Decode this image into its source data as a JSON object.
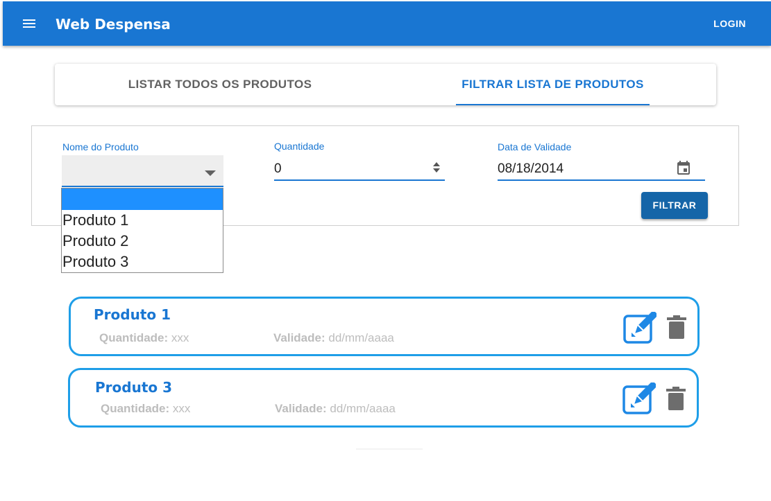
{
  "appbar": {
    "title": "Web Despensa",
    "login_label": "LOGIN"
  },
  "tabs": [
    {
      "label": "LISTAR TODOS OS PRODUTOS",
      "active": false
    },
    {
      "label": "FILTRAR LISTA DE PRODUTOS",
      "active": true
    }
  ],
  "filter": {
    "nome_label": "Nome do Produto",
    "nome_value": "",
    "quantidade_label": "Quantidade",
    "quantidade_value": "0",
    "data_label": "Data de Validade",
    "data_value": "08/18/2014",
    "filtrar_label": "FILTRAR",
    "dropdown_options": [
      "",
      "Produto 1",
      "Produto 2",
      "Produto 3"
    ]
  },
  "products": [
    {
      "name": "Produto 1",
      "quantidade_label": "Quantidade:",
      "quantidade_value": " xxx",
      "validade_label": "Validade:",
      "validade_value": " dd/mm/aaaa"
    },
    {
      "name": "Produto 3",
      "quantidade_label": "Quantidade:",
      "quantidade_value": " xxx",
      "validade_label": "Validade:",
      "validade_value": " dd/mm/aaaa"
    }
  ],
  "colors": {
    "primary": "#1976d2",
    "card_border": "#1e9ee8",
    "button": "#1565a8",
    "selected_option": "#1e90ff",
    "muted_text": "#bdbdbd"
  },
  "icons": [
    "menu-icon",
    "calendar-icon",
    "edit-icon",
    "delete-icon",
    "dropdown-arrow-icon"
  ]
}
